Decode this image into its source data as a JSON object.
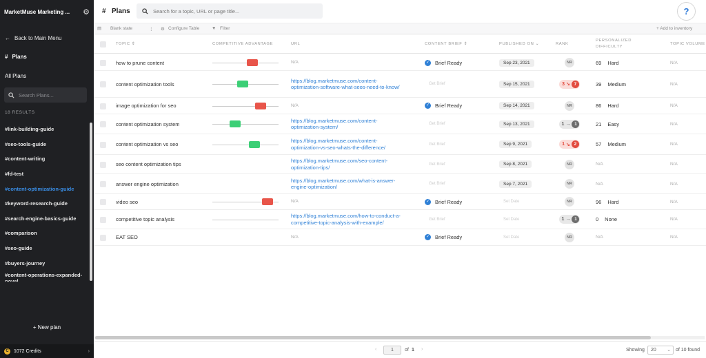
{
  "sidebar": {
    "workspace_title": "MarketMuse Marketing ...",
    "back_label": "Back to Main Menu",
    "plans_label": "Plans",
    "all_plans_label": "All Plans",
    "search_placeholder": "Search Plans...",
    "results_label": "18 RESULTS",
    "items": [
      {
        "label": "#link-building-guide",
        "active": false
      },
      {
        "label": "#seo-tools-guide",
        "active": false
      },
      {
        "label": "#content-writing",
        "active": false
      },
      {
        "label": "#fd-test",
        "active": false
      },
      {
        "label": "#content-optimization-guide",
        "active": true
      },
      {
        "label": "#keyword-research-guide",
        "active": false
      },
      {
        "label": "#search-engine-basics-guide",
        "active": false
      },
      {
        "label": "#comparison",
        "active": false
      },
      {
        "label": "#seo-guide",
        "active": false
      },
      {
        "label": "#buyers-journey",
        "active": false
      },
      {
        "label": "#content-operations-expanded-novel",
        "active": false
      }
    ],
    "new_plan_label": "+ New plan",
    "credits_label": "1072 Credits"
  },
  "topbar": {
    "title": "Plans",
    "search_placeholder": "Search for a topic, URL or page title...",
    "help_label": "?"
  },
  "toolbar": {
    "blank_state": "Blank state",
    "configure_table": "Configure Table",
    "filter": "Filter",
    "add_to_inventory": "+ Add to inventory"
  },
  "columns": {
    "topic": "TOPIC ⇕",
    "competitive_advantage": "COMPETITIVE ADVANTAGE",
    "url": "URL",
    "content_brief": "CONTENT BRIEF ⇕",
    "published_on": "PUBLISHED ON ⌄",
    "rank": "RANK",
    "personalized_difficulty": "PERSONALIZED DIFFICULTY",
    "topic_volume": "TOPIC VOLUME"
  },
  "rows": [
    {
      "topic": "how to prune content",
      "adv": 0.62,
      "adv_color": "#e8554a",
      "url": "",
      "brief": "Brief Ready",
      "date": "Sep 23, 2021",
      "rank": {
        "type": "nr"
      },
      "difficulty": "69",
      "difficulty_label": "Hard",
      "volume": "N/A"
    },
    {
      "topic": "content optimization tools",
      "adv": 0.45,
      "adv_color": "#3ccf76",
      "url": "https://blog.marketmuse.com/content-optimization-software-what-seos-need-to-know/",
      "brief": "",
      "date": "Sep 15, 2021",
      "rank": {
        "type": "red",
        "from": "3",
        "arrow": "↘",
        "to": "7"
      },
      "difficulty": "39",
      "difficulty_label": "Medium",
      "volume": "N/A"
    },
    {
      "topic": "image optimization for seo",
      "adv": 0.78,
      "adv_color": "#e8554a",
      "url": "",
      "brief": "Brief Ready",
      "date": "Sep 14, 2021",
      "rank": {
        "type": "nr"
      },
      "difficulty": "86",
      "difficulty_label": "Hard",
      "volume": "N/A"
    },
    {
      "topic": "content optimization system",
      "adv": 0.31,
      "adv_color": "#3ccf76",
      "url": "https://blog.marketmuse.com/content-optimization-system/",
      "brief": "",
      "date": "Sep 13, 2021",
      "rank": {
        "type": "gray",
        "from": "1",
        "arrow": "→",
        "to": "1"
      },
      "difficulty": "21",
      "difficulty_label": "Easy",
      "volume": "N/A"
    },
    {
      "topic": "content optimization vs seo",
      "adv": 0.66,
      "adv_color": "#3ccf76",
      "url": "https://blog.marketmuse.com/content-optimization-vs-seo-whats-the-difference/",
      "brief": "",
      "date": "Sep 9, 2021",
      "rank": {
        "type": "red",
        "from": "1",
        "arrow": "↘",
        "to": "2"
      },
      "difficulty": "57",
      "difficulty_label": "Medium",
      "volume": "N/A"
    },
    {
      "topic": "seo content optimization tips",
      "adv": null,
      "adv_color": "",
      "url": "https://blog.marketmuse.com/seo-content-optimization-tips/",
      "brief": "",
      "date": "Sep 8, 2021",
      "rank": {
        "type": "nr"
      },
      "difficulty": "N/A",
      "difficulty_label": "",
      "volume": "N/A"
    },
    {
      "topic": "answer engine optimization",
      "adv": null,
      "adv_color": "",
      "url": "https://blog.marketmuse.com/what-is-answer-engine-optimization/",
      "brief": "",
      "date": "Sep 7, 2021",
      "rank": {
        "type": "nr"
      },
      "difficulty": "N/A",
      "difficulty_label": "",
      "volume": "N/A"
    },
    {
      "topic": "video seo",
      "adv": 0.9,
      "adv_color": "#e8554a",
      "url": "",
      "brief": "Brief Ready",
      "date": "",
      "rank": {
        "type": "nr"
      },
      "difficulty": "96",
      "difficulty_label": "Hard",
      "volume": "N/A"
    },
    {
      "topic": "competitive topic analysis",
      "adv": 0,
      "adv_color": "",
      "url": "https://blog.marketmuse.com/how-to-conduct-a-competitive-topic-analysis-with-example/",
      "brief": "",
      "date": "",
      "rank": {
        "type": "gray",
        "from": "1",
        "arrow": "→",
        "to": "1"
      },
      "difficulty": "0",
      "difficulty_label": "None",
      "volume": "N/A"
    },
    {
      "topic": "EAT SEO",
      "adv": null,
      "adv_color": "",
      "url": "",
      "brief": "Brief Ready",
      "date": "",
      "rank": {
        "type": "nr"
      },
      "difficulty": "N/A",
      "difficulty_label": "",
      "volume": "N/A"
    }
  ],
  "labels": {
    "na": "N/A",
    "get_brief": "Get Brief",
    "set_date": "Set Date",
    "nr": "NR"
  },
  "pagination": {
    "page": "1",
    "of_label": "of",
    "total_pages": "1",
    "showing_label": "Showing",
    "page_size": "20",
    "found_label": "of 10 found"
  }
}
